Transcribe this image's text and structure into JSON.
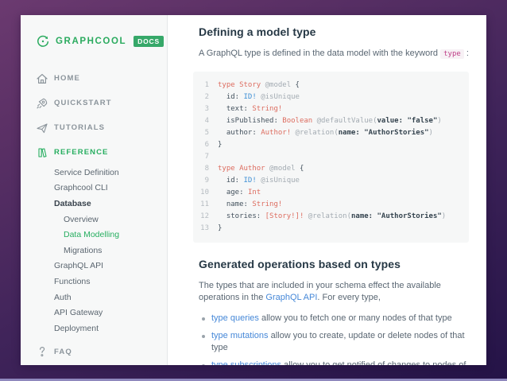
{
  "logo": {
    "name": "GRAPHCOOL",
    "badge": "DOCS"
  },
  "colors": {
    "accent_green": "#27ae60",
    "link_blue": "#4688d8",
    "inline_code_pink": "#bf3f88",
    "code_keyword": "#dd6d60",
    "code_scalar_blue": "#4191d6",
    "code_directive": "#a3abb2",
    "sidebar_bg": "#f7f8f8",
    "frame_gradient_top": "#6b3a70",
    "frame_gradient_bottom": "#241347"
  },
  "sidebar": {
    "sections": [
      {
        "label": "HOME",
        "icon": "home-icon",
        "active": false
      },
      {
        "label": "QUICKSTART",
        "icon": "rocket-icon",
        "active": false
      },
      {
        "label": "TUTORIALS",
        "icon": "paper-plane-icon",
        "active": false
      },
      {
        "label": "REFERENCE",
        "icon": "book-icon",
        "active": true
      }
    ],
    "reference_items": [
      {
        "label": "Service Definition",
        "level": 1,
        "state": "normal"
      },
      {
        "label": "Graphcool CLI",
        "level": 1,
        "state": "normal"
      },
      {
        "label": "Database",
        "level": 1,
        "state": "current-section"
      },
      {
        "label": "Overview",
        "level": 2,
        "state": "normal"
      },
      {
        "label": "Data Modelling",
        "level": 2,
        "state": "active"
      },
      {
        "label": "Migrations",
        "level": 2,
        "state": "normal"
      },
      {
        "label": "GraphQL API",
        "level": 1,
        "state": "normal"
      },
      {
        "label": "Functions",
        "level": 1,
        "state": "normal"
      },
      {
        "label": "Auth",
        "level": 1,
        "state": "normal"
      },
      {
        "label": "API Gateway",
        "level": 1,
        "state": "normal"
      },
      {
        "label": "Deployment",
        "level": 1,
        "state": "normal"
      }
    ],
    "faq": {
      "label": "FAQ",
      "icon": "question-icon"
    }
  },
  "content": {
    "section1": {
      "heading": "Defining a model type",
      "intro_before": "A GraphQL type is defined in the data model with the keyword ",
      "inline_code": "type",
      "intro_after": " :"
    },
    "code_block": {
      "lines": [
        {
          "n": "1",
          "t": [
            [
              "type Story ",
              "k"
            ],
            [
              "@model ",
              "d"
            ],
            [
              "{",
              "p"
            ]
          ]
        },
        {
          "n": "2",
          "t": [
            [
              "  id: ",
              "p"
            ],
            [
              "ID! ",
              "b"
            ],
            [
              "@isUnique",
              "d"
            ]
          ]
        },
        {
          "n": "3",
          "t": [
            [
              "  text: ",
              "p"
            ],
            [
              "String!",
              "k"
            ]
          ]
        },
        {
          "n": "4",
          "t": [
            [
              "  isPublished: ",
              "p"
            ],
            [
              "Boolean ",
              "k"
            ],
            [
              "@defaultValue(",
              "d"
            ],
            [
              "value: ",
              "s"
            ],
            [
              "\"false\"",
              "s"
            ],
            [
              ")",
              "d"
            ]
          ]
        },
        {
          "n": "5",
          "t": [
            [
              "  author: ",
              "p"
            ],
            [
              "Author! ",
              "k"
            ],
            [
              "@relation(",
              "d"
            ],
            [
              "name: ",
              "s"
            ],
            [
              "\"AuthorStories\"",
              "s"
            ],
            [
              ")",
              "d"
            ]
          ]
        },
        {
          "n": "6",
          "t": [
            [
              "}",
              "p"
            ]
          ]
        },
        {
          "n": "7",
          "t": []
        },
        {
          "n": "8",
          "t": [
            [
              "type Author ",
              "k"
            ],
            [
              "@model ",
              "d"
            ],
            [
              "{",
              "p"
            ]
          ]
        },
        {
          "n": "9",
          "t": [
            [
              "  id: ",
              "p"
            ],
            [
              "ID! ",
              "b"
            ],
            [
              "@isUnique",
              "d"
            ]
          ]
        },
        {
          "n": "10",
          "t": [
            [
              "  age: ",
              "p"
            ],
            [
              "Int",
              "k"
            ]
          ]
        },
        {
          "n": "11",
          "t": [
            [
              "  name: ",
              "p"
            ],
            [
              "String!",
              "k"
            ]
          ]
        },
        {
          "n": "12",
          "t": [
            [
              "  stories: ",
              "p"
            ],
            [
              "[Story!]! ",
              "k"
            ],
            [
              "@relation(",
              "d"
            ],
            [
              "name: ",
              "s"
            ],
            [
              "\"AuthorStories\"",
              "s"
            ],
            [
              ")",
              "d"
            ]
          ]
        },
        {
          "n": "13",
          "t": [
            [
              "}",
              "p"
            ]
          ]
        }
      ]
    },
    "section2": {
      "heading": "Generated operations based on types",
      "para_before": "The types that are included in your schema effect the available operations in the ",
      "para_link": "GraphQL API",
      "para_after": ". For every type,",
      "bullets": [
        {
          "link": "type queries",
          "text": " allow you to fetch one or many nodes of that type"
        },
        {
          "link": "type mutations",
          "text": " allow you to create, update or delete nodes of that type"
        },
        {
          "link": "type subscriptions",
          "text": " allow you to get notified of changes to nodes of that type"
        }
      ]
    }
  }
}
